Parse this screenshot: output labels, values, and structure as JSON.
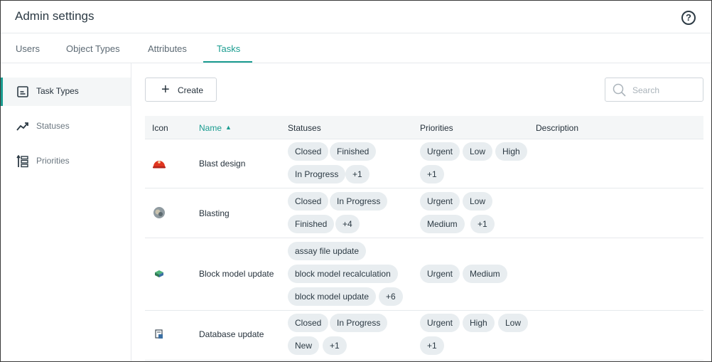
{
  "header": {
    "title": "Admin settings",
    "help_label": "?"
  },
  "tabs": [
    {
      "label": "Users",
      "active": false
    },
    {
      "label": "Object Types",
      "active": false
    },
    {
      "label": "Attributes",
      "active": false
    },
    {
      "label": "Tasks",
      "active": true
    }
  ],
  "sidebar": {
    "items": [
      {
        "label": "Task Types",
        "icon": "task-type-icon",
        "active": true
      },
      {
        "label": "Statuses",
        "icon": "trend-icon",
        "active": false
      },
      {
        "label": "Priorities",
        "icon": "priority-list-icon",
        "active": false
      }
    ]
  },
  "toolbar": {
    "create_label": "Create",
    "search_placeholder": "Search"
  },
  "table": {
    "columns": [
      "Icon",
      "Name",
      "Statuses",
      "Priorities",
      "Description"
    ],
    "sort": {
      "column": "Name",
      "direction": "ascending"
    },
    "rows": [
      {
        "name": "Blast design",
        "icon": "red-helmet-icon",
        "statuses": [
          "Closed",
          "Finished",
          "In Progress",
          "+1"
        ],
        "priorities": [
          "Urgent",
          "Low",
          "High",
          "+1"
        ],
        "description": ""
      },
      {
        "name": "Blasting",
        "icon": "blasting-icon",
        "statuses": [
          "Closed",
          "In Progress",
          "Finished",
          "+4"
        ],
        "priorities": [
          "Urgent",
          "Low",
          "Medium",
          "+1"
        ],
        "description": ""
      },
      {
        "name": "Block model update",
        "icon": "block-model-icon",
        "statuses": [
          "assay file update",
          "block model recalculation",
          "block model update",
          "+6"
        ],
        "priorities": [
          "Urgent",
          "Medium"
        ],
        "description": ""
      },
      {
        "name": "Database update",
        "icon": "database-icon",
        "statuses": [
          "Closed",
          "In Progress",
          "New",
          "+1"
        ],
        "priorities": [
          "Urgent",
          "High",
          "Low",
          "+1"
        ],
        "description": ""
      }
    ]
  },
  "colors": {
    "accent": "#1a9c90",
    "chip_bg": "#e8edf0",
    "text": "#26323c"
  }
}
